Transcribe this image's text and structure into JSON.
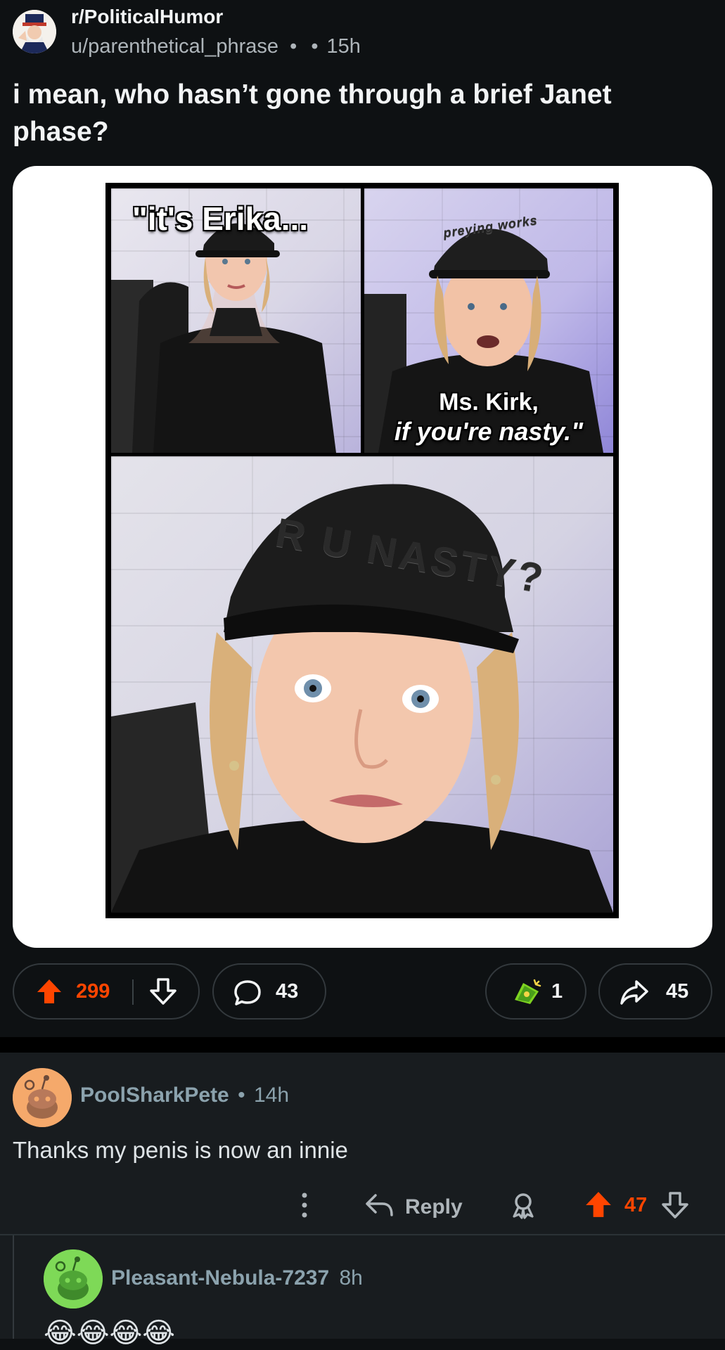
{
  "post": {
    "subreddit": "r/PoliticalHumor",
    "author": "u/parenthetical_phrase",
    "meta_separator": "•",
    "time_separator": "•",
    "time": "15h",
    "title": "i mean, who hasn’t gone through a brief Janet phase?"
  },
  "meme": {
    "caption_top_left": "\"it's Erika...",
    "caption_top_right_line1": "Ms. Kirk,",
    "caption_top_right_line2": "if you're nasty.\"",
    "hat_text_small": "preying works",
    "hat_text_large": "R U NASTY?"
  },
  "actions": {
    "upvotes": "299",
    "comments": "43",
    "awards": "1",
    "shares": "45"
  },
  "comments": [
    {
      "author": "PoolSharkPete",
      "time": "14h",
      "separator": "•",
      "body": "Thanks my penis is now an innie",
      "reply_label": "Reply",
      "votes": "47",
      "avatar_color": "#f5a96b"
    },
    {
      "author": "Pleasant-Nebula-7237",
      "time": "8h",
      "body": "😂😂😂😂",
      "avatar_color": "#7ed957"
    }
  ],
  "colors": {
    "background": "#0e1113",
    "upvote": "#ff4500",
    "muted_text": "#8ba2ad"
  }
}
